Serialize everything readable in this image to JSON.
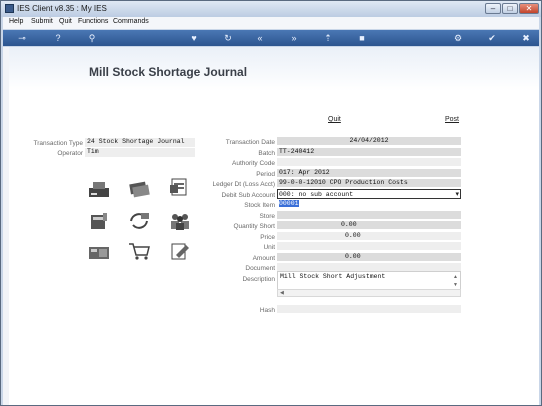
{
  "window": {
    "title": "IES Client v8.35 : My IES"
  },
  "menu": {
    "help": "Help",
    "submit": "Submit",
    "quit": "Quit",
    "functions": "Functions",
    "commands": "Commands"
  },
  "page": {
    "title": "Mill Stock Shortage Journal",
    "quit_link": "Quit",
    "post_link": "Post"
  },
  "left_form": {
    "transaction_type_label": "Transaction Type",
    "transaction_type_value": "24 Stock Shortage Journal",
    "operator_label": "Operator",
    "operator_value": "Tim"
  },
  "fields": {
    "transaction_date": {
      "label": "Transaction Date",
      "value": "24/04/2012"
    },
    "batch": {
      "label": "Batch",
      "value": "TT-240412"
    },
    "authority_code": {
      "label": "Authority Code",
      "value": ""
    },
    "period": {
      "label": "Period",
      "value": "017: Apr 2012"
    },
    "ledger_dt": {
      "label": "Ledger Dt (Loss Acct)",
      "value": "99-0-0-12010 CPO Production Costs"
    },
    "debit_sub_account": {
      "label": "Debit Sub Account",
      "value": "000: no sub account"
    },
    "stock_item": {
      "label": "Stock Item",
      "value": "00001"
    },
    "store": {
      "label": "Store",
      "value": ""
    },
    "quantity_short": {
      "label": "Quantity Short",
      "value": "0.00"
    },
    "price": {
      "label": "Price",
      "value": "0.00"
    },
    "unit": {
      "label": "Unit",
      "value": ""
    },
    "amount": {
      "label": "Amount",
      "value": "0.00"
    },
    "document": {
      "label": "Document",
      "value": ""
    },
    "description": {
      "label": "Description",
      "value": "Mill Stock Short Adjustment"
    },
    "hash": {
      "label": "Hash",
      "value": ""
    }
  },
  "colors": {
    "toolbar": "#2c558f",
    "field_bg": "#dcdcdc",
    "selection": "#3a6fd8"
  }
}
